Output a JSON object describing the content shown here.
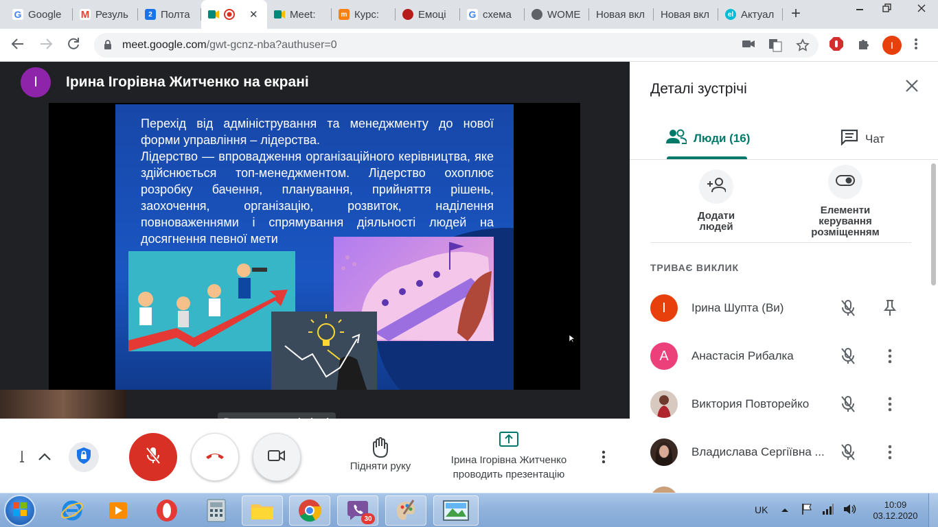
{
  "browser": {
    "tabs": [
      {
        "title": "Google",
        "icon": "google-icon",
        "color": "#4285f4"
      },
      {
        "title": "Резуль",
        "icon": "gmail-icon",
        "color": "#ea4335"
      },
      {
        "title": "Полта",
        "icon": "calendar-icon",
        "color": "#1a73e8",
        "badge": "2"
      },
      {
        "title": "",
        "icon": "meet-icon",
        "color": "#00897b",
        "active": true
      },
      {
        "title": "Meet:",
        "icon": "meet-icon",
        "color": "#00897b"
      },
      {
        "title": "Курс: ",
        "icon": "moodle-icon",
        "color": "#f98012"
      },
      {
        "title": "Емоці",
        "icon": "record-icon",
        "color": "#b71c1c"
      },
      {
        "title": "схема",
        "icon": "google-icon",
        "color": "#4285f4"
      },
      {
        "title": "WOME",
        "icon": "globe-icon",
        "color": "#5f6368"
      },
      {
        "title": "Новая вкл",
        "icon": "",
        "color": ""
      },
      {
        "title": "Новая вкл",
        "icon": "",
        "color": ""
      },
      {
        "title": "Актуал",
        "icon": "site-icon",
        "color": "#00bcd4",
        "badge": "el"
      }
    ],
    "new_tab": "+",
    "url_host": "meet.google.com",
    "url_path": "/gwt-gcnz-nba?authuser=0",
    "profile_initial": "I",
    "profile_color": "#e8400c"
  },
  "meeting": {
    "presenter_initial": "I",
    "presenter_color": "#8e24aa",
    "presenter_label": "Ірина Ігорівна Житченко на екрані",
    "slide": {
      "paragraph1": "Перехід від адміністрування та менеджменту до нової форми управління – лідерства.",
      "paragraph2": "Лідерство — впровадження організаційного керівництва, яке здійснюється топ-менеджментом. Лідерство охоплює розробку бачення, планування, прийняття рішень, заохочення, організацію, розвиток, наділення повноваженнями і спрямування діяльності людей на досягнення певної мети"
    },
    "tooltip": "Вимкнути камеру (ctrl + e)"
  },
  "controls": {
    "raise_hand": "Підняти руку",
    "presenting_line1": "Ірина Ігорівна Житченко",
    "presenting_line2": "проводить презентацію",
    "mic_color": "#d93025"
  },
  "panel": {
    "title": "Деталі зустрічі",
    "tab_people": "Люди (16)",
    "tab_chat": "Чат",
    "accent": "#00796b",
    "add_people_line1": "Додати",
    "add_people_line2": "людей",
    "layout_line1": "Елементи",
    "layout_line2": "керування",
    "layout_line3": "розміщенням",
    "section": "ТРИВАЄ ВИКЛИК",
    "participants": [
      {
        "name": "Ірина Шупта (Ви)",
        "initial": "I",
        "color": "#e8400c",
        "action": "pin-icon"
      },
      {
        "name": "Анастасія Рибалка",
        "initial": "A",
        "color": "#ec407a",
        "action": "more-icon"
      },
      {
        "name": "Виктория Повторейко",
        "initial": "",
        "color": "#c9b9b0",
        "action": "more-icon"
      },
      {
        "name": "Владислава Сергіївна ...",
        "initial": "",
        "color": "#3b2a24",
        "action": "more-icon"
      }
    ]
  },
  "taskbar": {
    "viber_badge": "30",
    "lang": "UK",
    "time": "10:09",
    "date": "03.12.2020"
  }
}
